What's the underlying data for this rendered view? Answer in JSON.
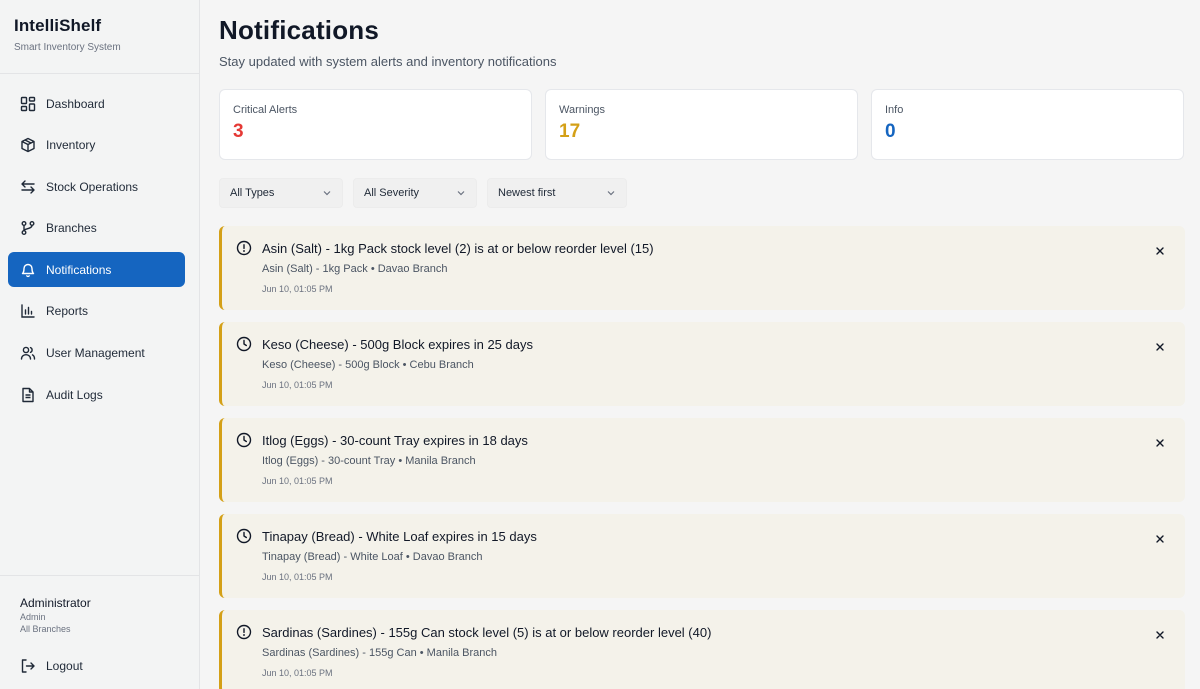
{
  "app": {
    "title": "IntelliShelf",
    "subtitle": "Smart Inventory System"
  },
  "sidebar": {
    "items": [
      {
        "label": "Dashboard",
        "icon": "dashboard-icon",
        "active": false
      },
      {
        "label": "Inventory",
        "icon": "box-icon",
        "active": false
      },
      {
        "label": "Stock Operations",
        "icon": "arrows-swap-icon",
        "active": false
      },
      {
        "label": "Branches",
        "icon": "git-branch-icon",
        "active": false
      },
      {
        "label": "Notifications",
        "icon": "bell-icon",
        "active": true
      },
      {
        "label": "Reports",
        "icon": "bar-chart-icon",
        "active": false
      },
      {
        "label": "User Management",
        "icon": "users-icon",
        "active": false
      },
      {
        "label": "Audit Logs",
        "icon": "document-icon",
        "active": false
      }
    ],
    "user": {
      "name": "Administrator",
      "role": "Admin",
      "branch": "All Branches"
    },
    "logout_label": "Logout"
  },
  "page": {
    "title": "Notifications",
    "subtitle": "Stay updated with system alerts and inventory notifications"
  },
  "stats": [
    {
      "label": "Critical Alerts",
      "value": "3",
      "color": "#e53935"
    },
    {
      "label": "Warnings",
      "value": "17",
      "color": "#d4a017"
    },
    {
      "label": "Info",
      "value": "0",
      "color": "#1565c0"
    }
  ],
  "filters": [
    {
      "selected": "All Types"
    },
    {
      "selected": "All Severity"
    },
    {
      "selected": "Newest first"
    }
  ],
  "notifications": [
    {
      "icon": "alert-circle-icon",
      "title": "Asin (Salt) - 1kg Pack stock level (2) is at or below reorder level (15)",
      "product": "Asin (Salt) - 1kg Pack",
      "branch": "Davao Branch",
      "time": "Jun 10, 01:05 PM"
    },
    {
      "icon": "clock-icon",
      "title": "Keso (Cheese) - 500g Block expires in 25 days",
      "product": "Keso (Cheese) - 500g Block",
      "branch": "Cebu Branch",
      "time": "Jun 10, 01:05 PM"
    },
    {
      "icon": "clock-icon",
      "title": "Itlog (Eggs) - 30-count Tray expires in 18 days",
      "product": "Itlog (Eggs) - 30-count Tray",
      "branch": "Manila Branch",
      "time": "Jun 10, 01:05 PM"
    },
    {
      "icon": "clock-icon",
      "title": "Tinapay (Bread) - White Loaf expires in 15 days",
      "product": "Tinapay (Bread) - White Loaf",
      "branch": "Davao Branch",
      "time": "Jun 10, 01:05 PM"
    },
    {
      "icon": "alert-circle-icon",
      "title": "Sardinas (Sardines) - 155g Can stock level (5) is at or below reorder level (40)",
      "product": "Sardinas (Sardines) - 155g Can",
      "branch": "Manila Branch",
      "time": "Jun 10, 01:05 PM"
    }
  ],
  "colors": {
    "accent": "#1565c0",
    "warning_border": "#d4a017",
    "notification_bg": "#f4f2ea"
  }
}
